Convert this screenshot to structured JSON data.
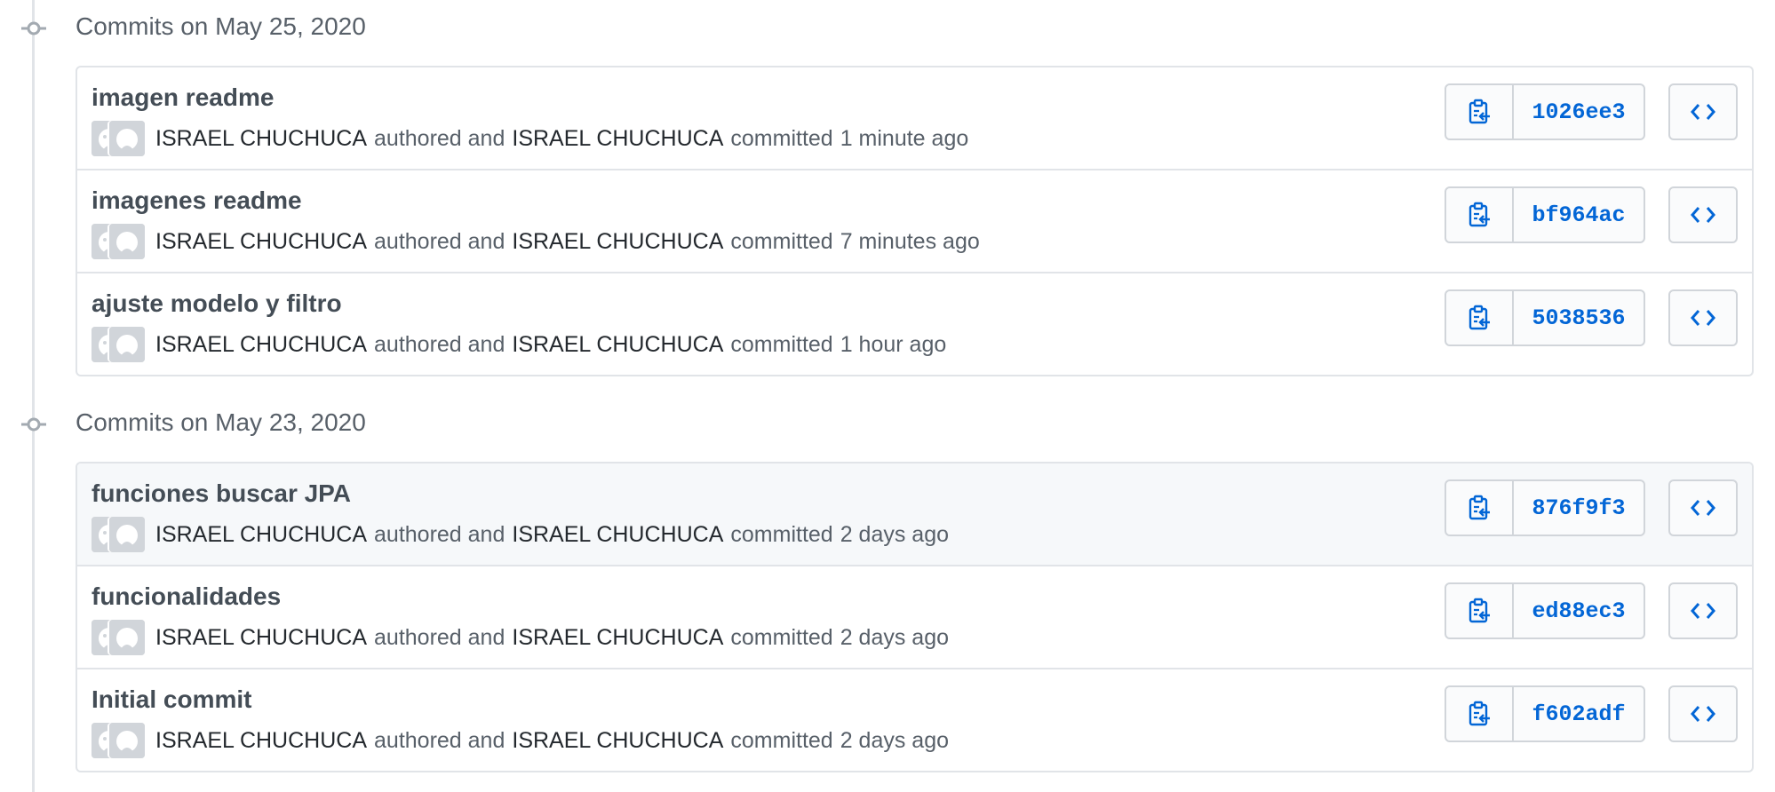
{
  "colors": {
    "link_blue": "#0366d6",
    "border": "#e1e4e8",
    "muted_text": "#586069",
    "highlight_row": "#f6f8fa"
  },
  "groups": [
    {
      "title": "Commits on May 25, 2020",
      "commits": [
        {
          "message": "imagen readme",
          "author": "ISRAEL CHUCHUCA",
          "authored_text": "authored and",
          "committer": "ISRAEL CHUCHUCA",
          "committed_text": "committed",
          "time": "1 minute ago",
          "sha": "1026ee3"
        },
        {
          "message": "imagenes readme",
          "author": "ISRAEL CHUCHUCA",
          "authored_text": "authored and",
          "committer": "ISRAEL CHUCHUCA",
          "committed_text": "committed",
          "time": "7 minutes ago",
          "sha": "bf964ac"
        },
        {
          "message": "ajuste modelo y filtro",
          "author": "ISRAEL CHUCHUCA",
          "authored_text": "authored and",
          "committer": "ISRAEL CHUCHUCA",
          "committed_text": "committed",
          "time": "1 hour ago",
          "sha": "5038536"
        }
      ]
    },
    {
      "title": "Commits on May 23, 2020",
      "commits": [
        {
          "message": "funciones buscar JPA",
          "author": "ISRAEL CHUCHUCA",
          "authored_text": "authored and",
          "committer": "ISRAEL CHUCHUCA",
          "committed_text": "committed",
          "time": "2 days ago",
          "sha": "876f9f3"
        },
        {
          "message": "funcionalidades",
          "author": "ISRAEL CHUCHUCA",
          "authored_text": "authored and",
          "committer": "ISRAEL CHUCHUCA",
          "committed_text": "committed",
          "time": "2 days ago",
          "sha": "ed88ec3"
        },
        {
          "message": "Initial commit",
          "author": "ISRAEL CHUCHUCA",
          "authored_text": "authored and",
          "committer": "ISRAEL CHUCHUCA",
          "committed_text": "committed",
          "time": "2 days ago",
          "sha": "f602adf"
        }
      ]
    }
  ],
  "icons": {
    "timeline": "git-commit-icon",
    "copy": "clipboard-icon",
    "browse": "code-icon",
    "avatar": "github-avatar"
  }
}
